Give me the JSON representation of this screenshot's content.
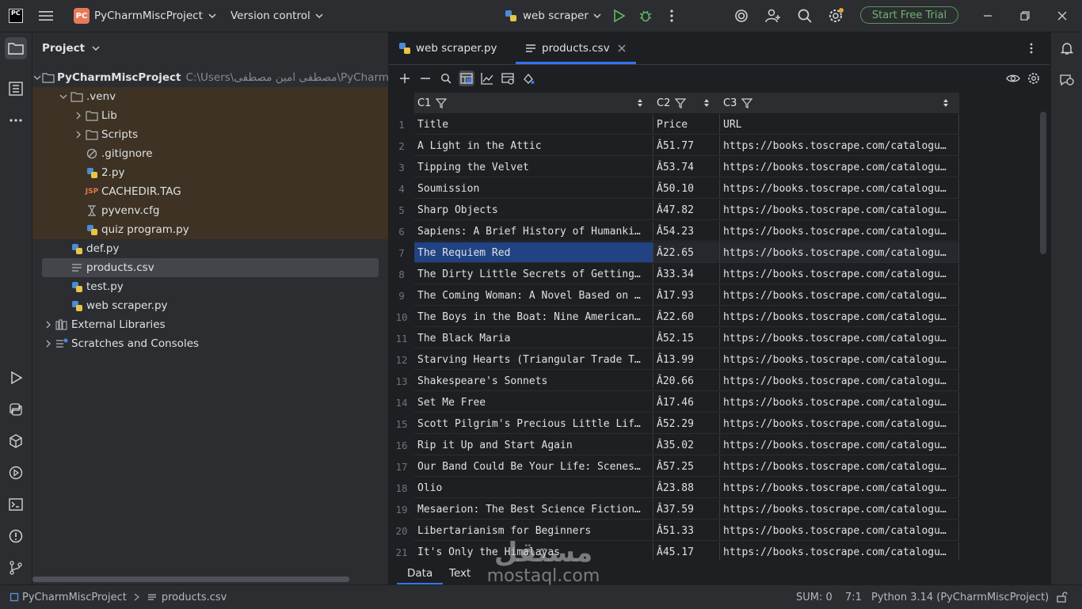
{
  "titlebar": {
    "app_logo": "PC",
    "project_badge": "PC",
    "project_name": "PyCharmMiscProject",
    "version_control": "Version control",
    "run_config": "web scraper",
    "start_trial": "Start Free Trial"
  },
  "project_panel": {
    "title": "Project",
    "root_name": "PyCharmMiscProject",
    "root_path": "C:\\Users\\مصطفى امين مصطفى\\PyCharmMiscP",
    "items": [
      {
        "label": ".venv",
        "type": "folder",
        "depth": 1,
        "expanded": true
      },
      {
        "label": "Lib",
        "type": "folder",
        "depth": 2,
        "expanded": false
      },
      {
        "label": "Scripts",
        "type": "folder",
        "depth": 2,
        "expanded": false
      },
      {
        "label": ".gitignore",
        "type": "ignore",
        "depth": 2
      },
      {
        "label": "2.py",
        "type": "python",
        "depth": 2
      },
      {
        "label": "CACHEDIR.TAG",
        "type": "tag",
        "depth": 2
      },
      {
        "label": "pyvenv.cfg",
        "type": "cfg",
        "depth": 2
      },
      {
        "label": "quiz program.py",
        "type": "python",
        "depth": 2
      },
      {
        "label": "def.py",
        "type": "python",
        "depth": 1
      },
      {
        "label": "products.csv",
        "type": "csv",
        "depth": 1,
        "selected": true
      },
      {
        "label": "test.py",
        "type": "python",
        "depth": 1
      },
      {
        "label": "web scraper.py",
        "type": "python",
        "depth": 1
      },
      {
        "label": "External Libraries",
        "type": "libs",
        "depth": 0
      },
      {
        "label": "Scratches and Consoles",
        "type": "scratch",
        "depth": 0
      }
    ]
  },
  "editor": {
    "tabs": [
      {
        "label": "web scraper.py",
        "active": false
      },
      {
        "label": "products.csv",
        "active": true
      }
    ],
    "columns": [
      {
        "label": "C1"
      },
      {
        "label": "C2"
      },
      {
        "label": "C3"
      }
    ],
    "rows": [
      {
        "n": "1",
        "c1": "Title",
        "c2": "Price",
        "c3": "URL"
      },
      {
        "n": "2",
        "c1": "A Light in the Attic",
        "c2": "Â51.77",
        "c3": "https://books.toscrape.com/catalogu…"
      },
      {
        "n": "3",
        "c1": "Tipping the Velvet",
        "c2": "Â53.74",
        "c3": "https://books.toscrape.com/catalogu…"
      },
      {
        "n": "4",
        "c1": "Soumission",
        "c2": "Â50.10",
        "c3": "https://books.toscrape.com/catalogu…"
      },
      {
        "n": "5",
        "c1": "Sharp Objects",
        "c2": "Â47.82",
        "c3": "https://books.toscrape.com/catalogu…"
      },
      {
        "n": "6",
        "c1": "Sapiens: A Brief History of Humanki…",
        "c2": "Â54.23",
        "c3": "https://books.toscrape.com/catalogu…"
      },
      {
        "n": "7",
        "c1": "The Requiem Red",
        "c2": "Â22.65",
        "c3": "https://books.toscrape.com/catalogu…"
      },
      {
        "n": "8",
        "c1": "The Dirty Little Secrets of Getting…",
        "c2": "Â33.34",
        "c3": "https://books.toscrape.com/catalogu…"
      },
      {
        "n": "9",
        "c1": "The Coming Woman: A Novel Based on …",
        "c2": "Â17.93",
        "c3": "https://books.toscrape.com/catalogu…"
      },
      {
        "n": "10",
        "c1": "The Boys in the Boat: Nine American…",
        "c2": "Â22.60",
        "c3": "https://books.toscrape.com/catalogu…"
      },
      {
        "n": "11",
        "c1": "The Black Maria",
        "c2": "Â52.15",
        "c3": "https://books.toscrape.com/catalogu…"
      },
      {
        "n": "12",
        "c1": "Starving Hearts (Triangular Trade T…",
        "c2": "Â13.99",
        "c3": "https://books.toscrape.com/catalogu…"
      },
      {
        "n": "13",
        "c1": "Shakespeare's Sonnets",
        "c2": "Â20.66",
        "c3": "https://books.toscrape.com/catalogu…"
      },
      {
        "n": "14",
        "c1": "Set Me Free",
        "c2": "Â17.46",
        "c3": "https://books.toscrape.com/catalogu…"
      },
      {
        "n": "15",
        "c1": "Scott Pilgrim's Precious Little Lif…",
        "c2": "Â52.29",
        "c3": "https://books.toscrape.com/catalogu…"
      },
      {
        "n": "16",
        "c1": "Rip it Up and Start Again",
        "c2": "Â35.02",
        "c3": "https://books.toscrape.com/catalogu…"
      },
      {
        "n": "17",
        "c1": "Our Band Could Be Your Life: Scenes…",
        "c2": "Â57.25",
        "c3": "https://books.toscrape.com/catalogu…"
      },
      {
        "n": "18",
        "c1": "Olio",
        "c2": "Â23.88",
        "c3": "https://books.toscrape.com/catalogu…"
      },
      {
        "n": "19",
        "c1": "Mesaerion: The Best Science Fiction…",
        "c2": "Â37.59",
        "c3": "https://books.toscrape.com/catalogu…"
      },
      {
        "n": "20",
        "c1": "Libertarianism for Beginners",
        "c2": "Â51.33",
        "c3": "https://books.toscrape.com/catalogu…"
      },
      {
        "n": "21",
        "c1": "It's Only the Himalayas",
        "c2": "Â45.17",
        "c3": "https://books.toscrape.com/catalogu…"
      }
    ],
    "selected_row": "7",
    "view_tabs": [
      {
        "label": "Data",
        "active": true
      },
      {
        "label": "Text",
        "active": false
      }
    ]
  },
  "statusbar": {
    "breadcrumb_project": "PyCharmMiscProject",
    "breadcrumb_file": "products.csv",
    "sum": "SUM: 0",
    "position": "7:1",
    "interpreter": "Python 3.14 (PyCharmMiscProject)"
  },
  "watermark": {
    "arabic": "مستقل",
    "latin": "mostaql.com"
  },
  "colors": {
    "accent": "#3574f0",
    "selection": "#214283",
    "trial_green": "#57965c",
    "venv_highlight": "#3d3223"
  }
}
